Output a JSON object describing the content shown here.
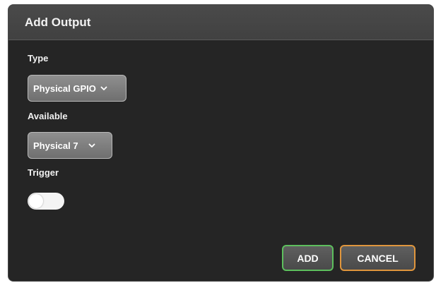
{
  "dialog": {
    "title": "Add Output",
    "type": {
      "label": "Type",
      "selected": "Physical GPIO"
    },
    "available": {
      "label": "Available",
      "selected": "Physical 7"
    },
    "trigger": {
      "label": "Trigger",
      "enabled": false
    },
    "buttons": {
      "add": "ADD",
      "cancel": "CANCEL"
    }
  },
  "colors": {
    "dialog_background": "#252525",
    "titlebar": "#444444",
    "add_border": "#5dbf5d",
    "cancel_border": "#e0963d"
  },
  "icons": {
    "dropdown": "chevron-down-icon"
  }
}
